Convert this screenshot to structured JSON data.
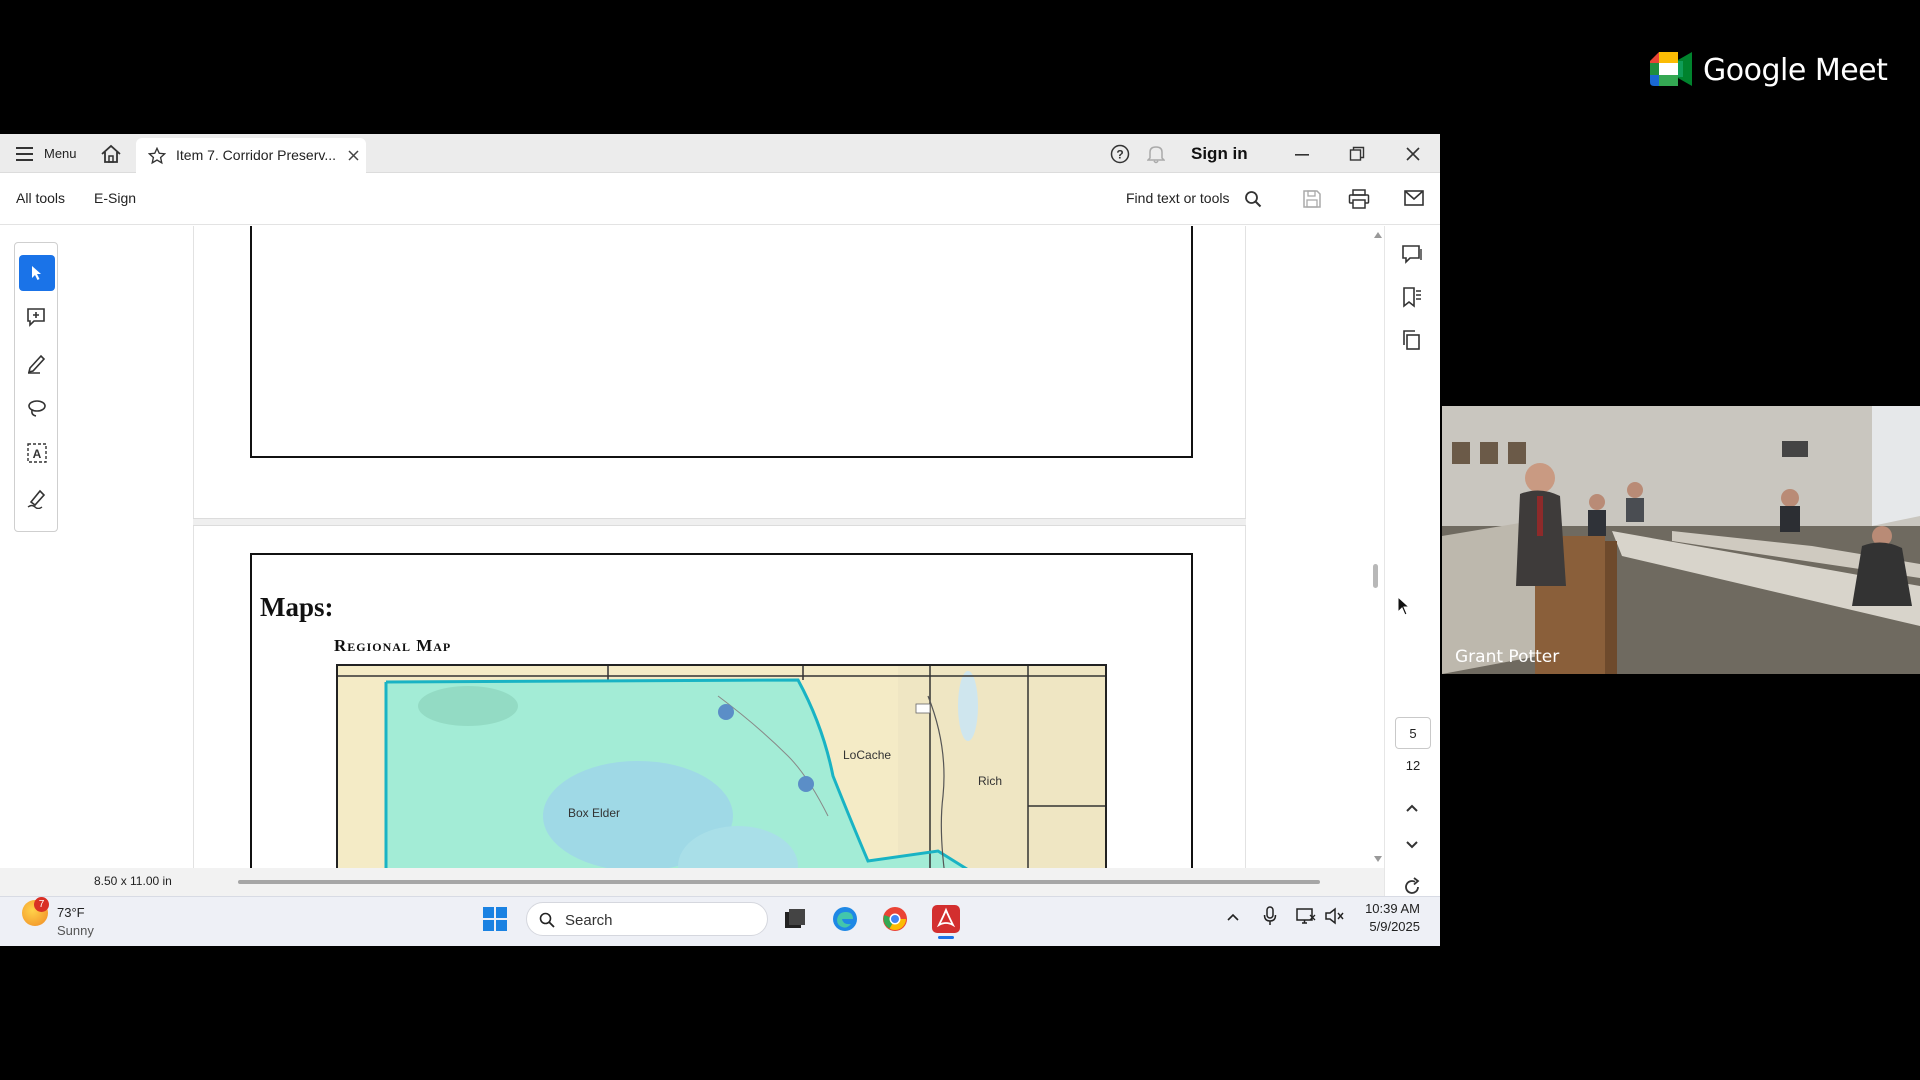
{
  "meet": {
    "brand": "Google Meet",
    "participant_name": "Grant Potter"
  },
  "acrobat": {
    "menu_label": "Menu",
    "tab_title": "Item 7. Corridor Preserv...",
    "sign_in": "Sign in",
    "toolbar": {
      "all_tools": "All tools",
      "esign": "E-Sign",
      "find": "Find text or tools"
    },
    "document": {
      "heading": "Maps:",
      "map_title": "Regional Map",
      "map_labels": {
        "box_elder": "Box Elder",
        "cache": "LoCache",
        "rich": "Rich"
      }
    },
    "page_size": "8.50 x 11.00 in",
    "page_current": "5",
    "page_total": "12",
    "colors": {
      "accent": "#1a73e8",
      "map_region": "#9ee8d2",
      "map_border": "#19b3c4"
    }
  },
  "taskbar": {
    "weather_badge": "7",
    "weather_temp": "73°F",
    "weather_cond": "Sunny",
    "search_placeholder": "Search",
    "time": "10:39 AM",
    "date": "5/9/2025"
  }
}
